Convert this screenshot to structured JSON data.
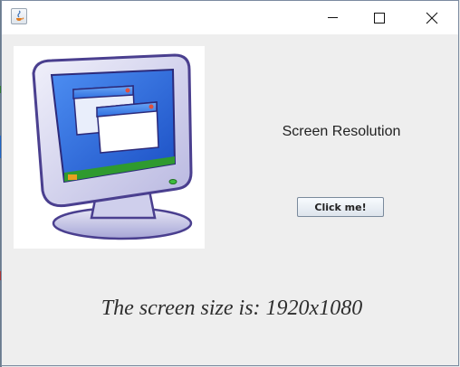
{
  "window": {
    "controls": {
      "minimize_icon": "minimize-icon",
      "maximize_icon": "maximize-icon",
      "close_icon": "close-icon"
    },
    "app_icon": "java-icon"
  },
  "main": {
    "illustration_icon": "computer-monitor-icon",
    "resolution_label": "Screen Resolution",
    "button_label": "Click me!",
    "result_text": "The screen size is: 1920x1080"
  },
  "colors": {
    "window_bg": "#eeeeee",
    "titlebar_bg": "#ffffff",
    "screen_blue": "#2a62d8"
  }
}
